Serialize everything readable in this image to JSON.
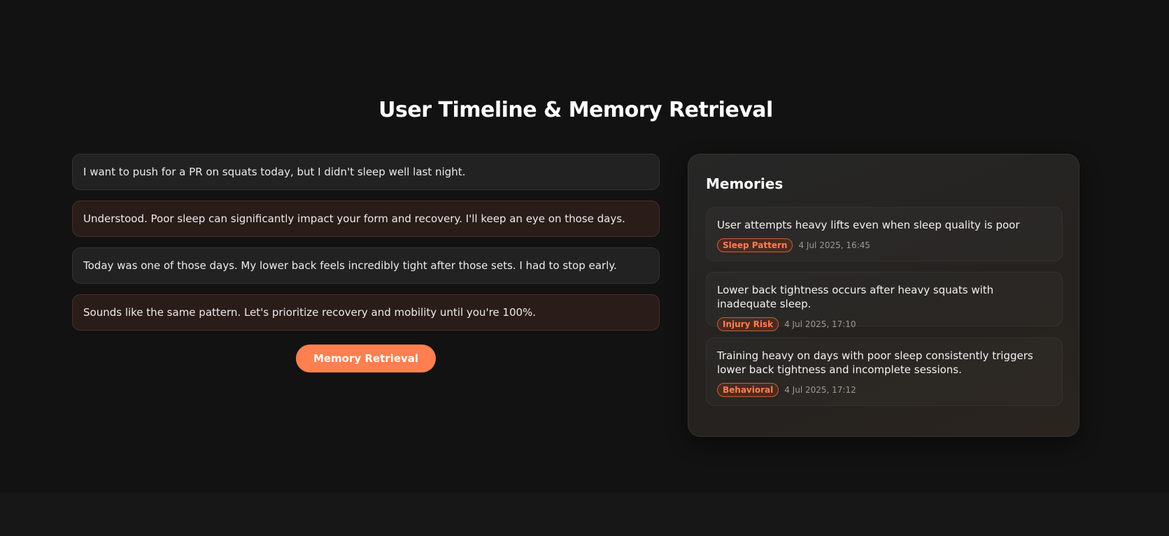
{
  "page": {
    "title": "User Timeline & Memory Retrieval"
  },
  "timeline": {
    "messages": [
      {
        "role": "user",
        "text": "I want to push for a PR on squats today, but I didn't sleep well last night."
      },
      {
        "role": "assistant",
        "text": "Understood. Poor sleep can significantly impact your form and recovery. I'll keep an eye on those days."
      },
      {
        "role": "user",
        "text": "Today was one of those days. My lower back feels incredibly tight after those sets. I had to stop early."
      },
      {
        "role": "assistant",
        "text": "Sounds like the same pattern. Let's prioritize recovery and mobility until you're 100%."
      }
    ],
    "cta_label": "Memory Retrieval"
  },
  "memories": {
    "title": "Memories",
    "items": [
      {
        "text": "User attempts heavy lifts even when sleep quality is poor",
        "tag": "Sleep Pattern",
        "date": "4 Jul 2025, 16:45"
      },
      {
        "text": "Lower back tightness occurs after heavy squats with inadequate sleep.",
        "tag": "Injury Risk",
        "date": "4 Jul 2025, 17:10"
      },
      {
        "text": "Training heavy on days with poor sleep consistently triggers lower back tightness and incomplete sessions.",
        "tag": "Behavioral",
        "date": "4 Jul 2025, 17:12"
      }
    ]
  },
  "colors": {
    "accent": "#ff7f50",
    "background": "#121212",
    "user_bubble": "#222222",
    "assistant_bubble": "#2a1c18"
  }
}
